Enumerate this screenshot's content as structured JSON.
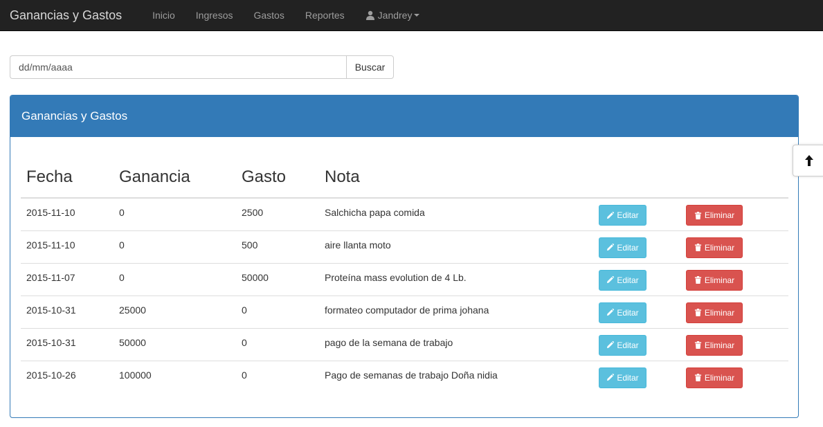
{
  "navbar": {
    "brand": "Ganancias y Gastos",
    "items": [
      {
        "label": "Inicio"
      },
      {
        "label": "Ingresos"
      },
      {
        "label": "Gastos"
      },
      {
        "label": "Reportes"
      }
    ],
    "user": {
      "label": "Jandrey",
      "icon": "user-icon"
    }
  },
  "search": {
    "placeholder": "dd/mm/aaaa",
    "button_label": "Buscar"
  },
  "panel": {
    "title": "Ganancias y Gastos",
    "columns": [
      "Fecha",
      "Ganancia",
      "Gasto",
      "Nota"
    ],
    "edit_label": "Editar",
    "delete_label": "Eliminar",
    "rows": [
      {
        "fecha": "2015-11-10",
        "ganancia": "0",
        "gasto": "2500",
        "nota": "Salchicha papa comida"
      },
      {
        "fecha": "2015-11-10",
        "ganancia": "0",
        "gasto": "500",
        "nota": "aire llanta moto"
      },
      {
        "fecha": "2015-11-07",
        "ganancia": "0",
        "gasto": "50000",
        "nota": "Proteína mass evolution de 4 Lb."
      },
      {
        "fecha": "2015-10-31",
        "ganancia": "25000",
        "gasto": "0",
        "nota": "formateo computador de prima johana"
      },
      {
        "fecha": "2015-10-31",
        "ganancia": "50000",
        "gasto": "0",
        "nota": "pago de la semana de trabajo"
      },
      {
        "fecha": "2015-10-26",
        "ganancia": "100000",
        "gasto": "0",
        "nota": "Pago de semanas de trabajo Doña nidia"
      }
    ]
  },
  "colors": {
    "navbar_bg": "#222222",
    "panel_primary": "#337ab7",
    "edit_button": "#5bc0de",
    "delete_button": "#d9534f"
  },
  "icons": {
    "edit": "pencil-icon",
    "delete": "trash-icon",
    "scroll_top": "arrow-up-icon"
  }
}
